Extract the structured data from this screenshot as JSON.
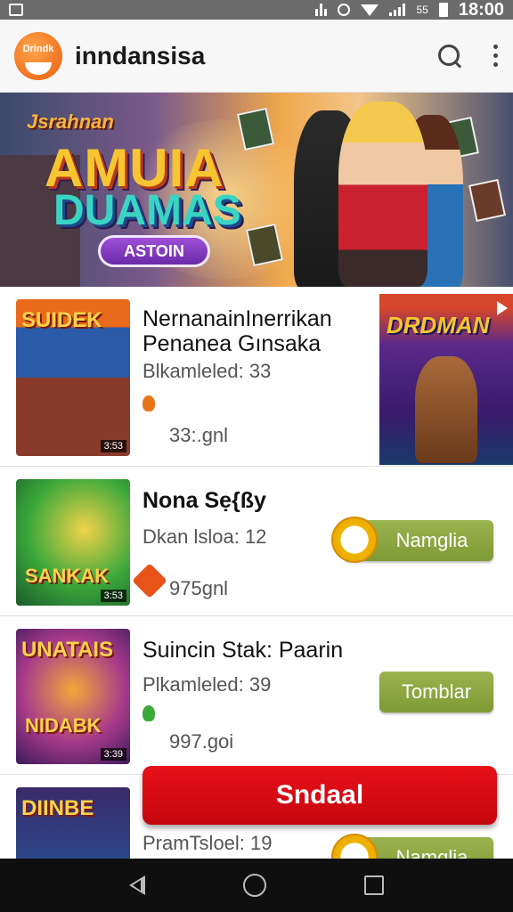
{
  "status_bar": {
    "battery": "55",
    "time": "18:00"
  },
  "app_bar": {
    "logo_text": "Drindk",
    "title": "inndansisa"
  },
  "banner": {
    "supertitle": "Jsrahnan",
    "title_line1": "AMUIA",
    "title_line2": "DUAMAS",
    "button_label": "ASTOIN"
  },
  "rows": [
    {
      "thumb_title": "SUIDEK",
      "thumb_badge": "3:53",
      "title": "NernanainInerrikan Penanea Gınsaka",
      "meta": "Blkamleled: 33",
      "size": "33:.gnl",
      "side_card_title": "DRDMAN"
    },
    {
      "thumb_title": "SANKAK",
      "thumb_badge": "3:53",
      "title": "Nona Sẹ{ßy",
      "meta": "Dkan lsloa: 12",
      "size": "975gnl",
      "button_label": "Namglia"
    },
    {
      "thumb_title": "UNATAIS",
      "thumb_sub": "NIDABK",
      "thumb_badge": "3:39",
      "title": "Suincin Stak: Paarin",
      "meta": "Plkamleled: 39",
      "size": "997.goi",
      "button_label": "Tomblar"
    },
    {
      "thumb_title": "DIINBE",
      "meta": "PramTsloel: 19",
      "button_label": "Namglia"
    }
  ],
  "fab_label": "Sndaal",
  "colors": {
    "accent_red": "#d60a14",
    "button_green": "#8ca63f",
    "logo_orange": "#e8751a"
  },
  "icons": [
    "search-icon",
    "more-vert-icon",
    "back-icon",
    "home-icon",
    "recents-icon"
  ]
}
